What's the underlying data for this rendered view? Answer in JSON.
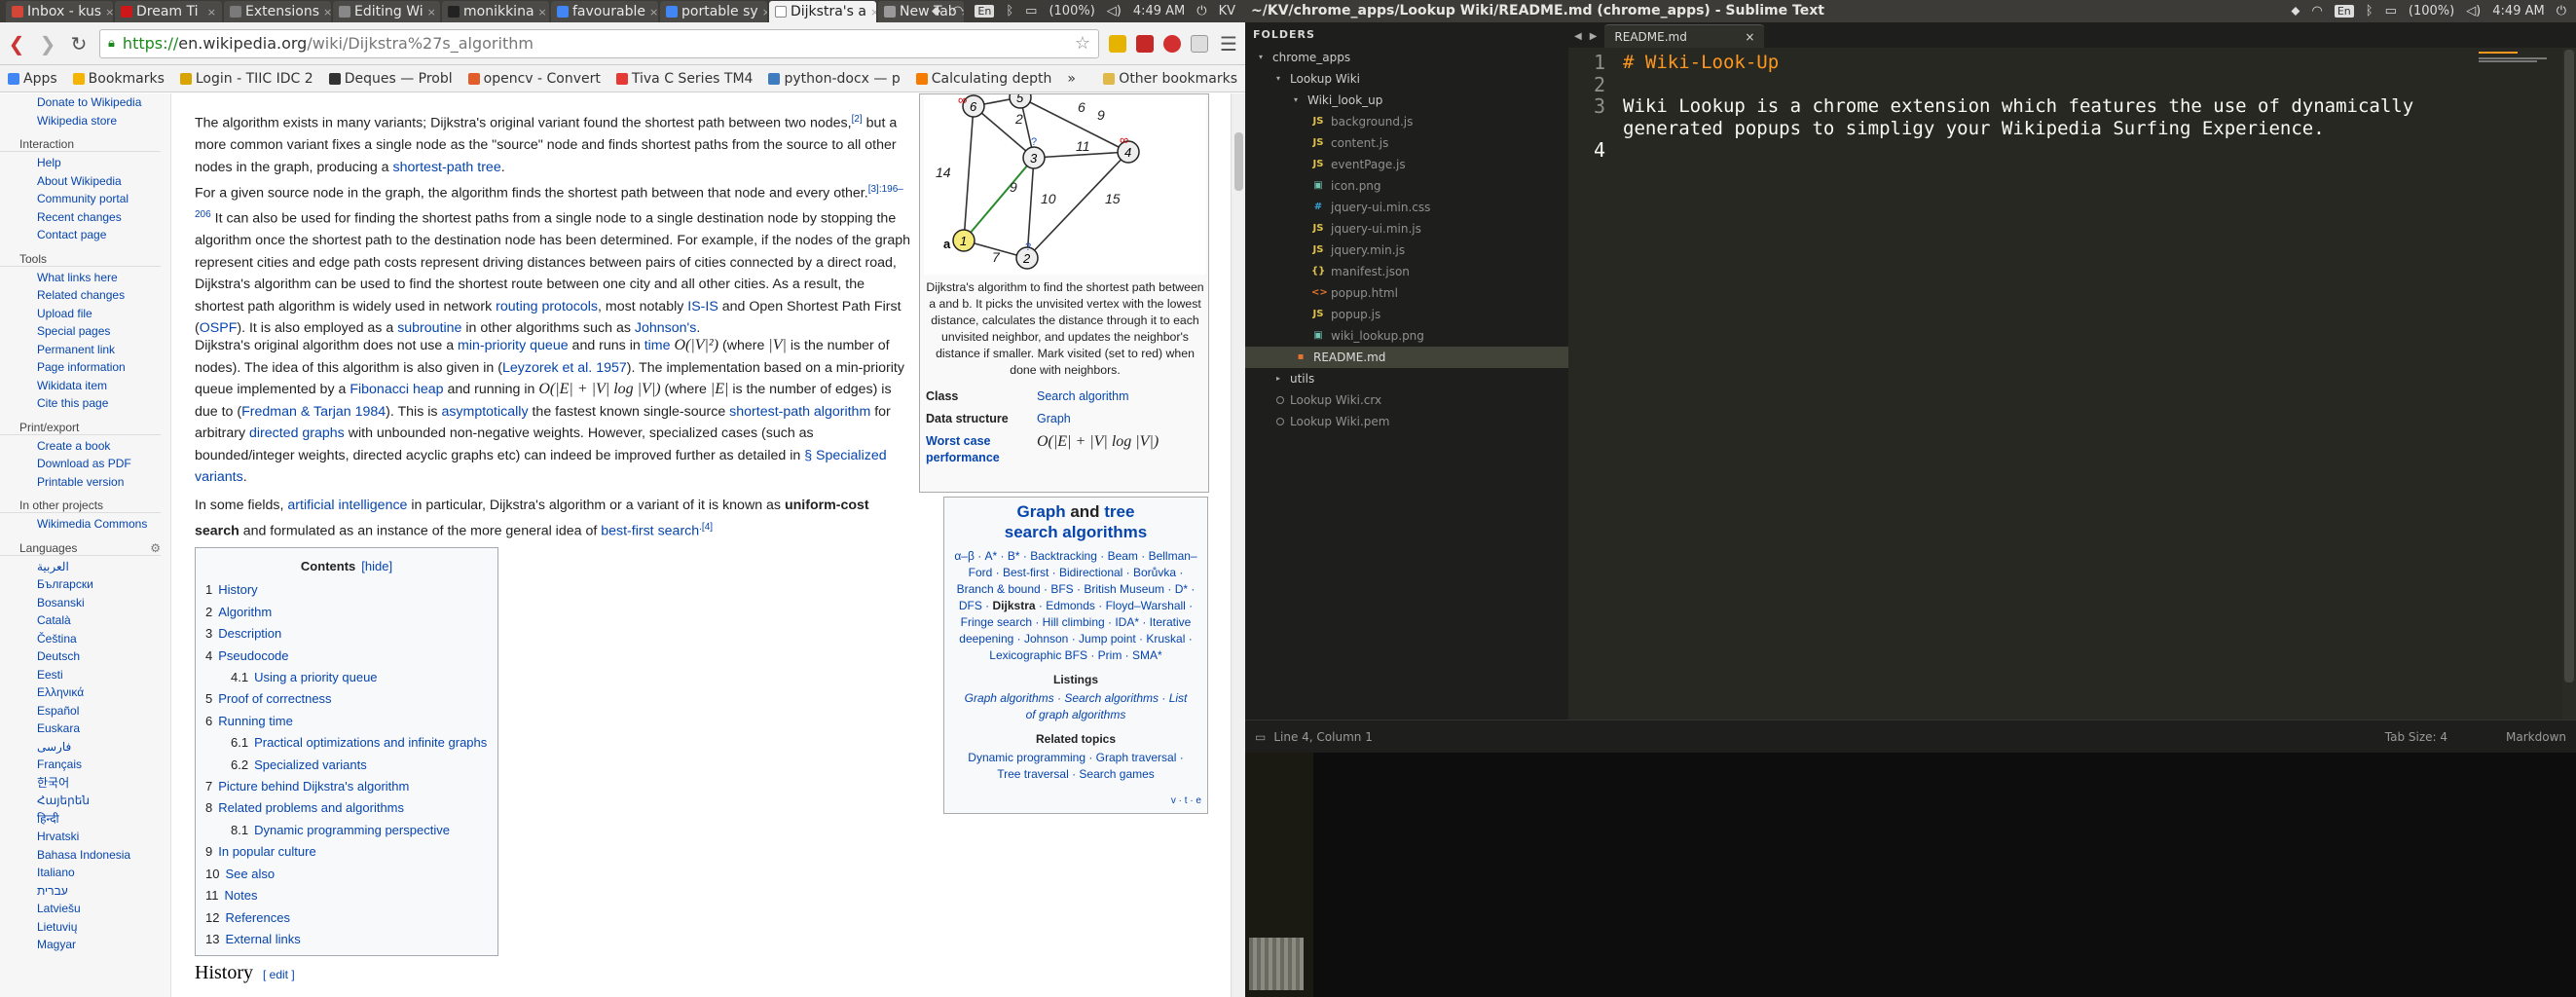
{
  "system": {
    "time": "4:49 AM",
    "battery": "(100%)",
    "lang": "En",
    "menu_right": "KV"
  },
  "chrome": {
    "tabs": [
      {
        "label": "Inbox - kus",
        "color": "#d44638"
      },
      {
        "label": "Dream Ti",
        "color": "#cc1818"
      },
      {
        "label": "Extensions",
        "color": "#7a7a7a"
      },
      {
        "label": "Editing Wi",
        "color": "#888"
      },
      {
        "label": "monikkina",
        "color": "#222"
      },
      {
        "label": "favourable",
        "color": "#4285f4"
      },
      {
        "label": "portable sy",
        "color": "#4285f4"
      },
      {
        "label": "Dijkstra's a",
        "color": "#fff"
      },
      {
        "label": "New Tab",
        "color": "#999"
      }
    ],
    "url_scheme": "https://",
    "url_host": "en.wikipedia.org",
    "url_path": "/wiki/Dijkstra%27s_algorithm",
    "bookmarks": [
      "Apps",
      "Bookmarks",
      "Login - TIIC IDC 2",
      "Deques — Probl",
      "opencv - Convert",
      "Tiva C Series TM4",
      "python-docx — p",
      "Calculating depth"
    ],
    "bookmarks_more": "»",
    "other_bookmarks": "Other bookmarks"
  },
  "wiki": {
    "sidebar_top": [
      "Donate to Wikipedia",
      "Wikipedia store"
    ],
    "interaction_head": "Interaction",
    "interaction": [
      "Help",
      "About Wikipedia",
      "Community portal",
      "Recent changes",
      "Contact page"
    ],
    "tools_head": "Tools",
    "tools": [
      "What links here",
      "Related changes",
      "Upload file",
      "Special pages",
      "Permanent link",
      "Page information",
      "Wikidata item",
      "Cite this page"
    ],
    "print_head": "Print/export",
    "print": [
      "Create a book",
      "Download as PDF",
      "Printable version"
    ],
    "other_head": "In other projects",
    "other": [
      "Wikimedia Commons"
    ],
    "lang_head": "Languages",
    "languages": [
      "العربية",
      "Български",
      "Bosanski",
      "Català",
      "Čeština",
      "Deutsch",
      "Eesti",
      "Ελληνικά",
      "Español",
      "Euskara",
      "فارسی",
      "Français",
      "한국어",
      "Հայերեն",
      "हिन्दी",
      "Hrvatski",
      "Bahasa Indonesia",
      "Italiano",
      "עברית",
      "Latviešu",
      "Lietuvių",
      "Magyar"
    ],
    "p1a": "The algorithm exists in many variants; Dijkstra's original variant found the shortest path between two nodes,",
    "p1ref": "[2]",
    "p1b": " but a more common variant fixes a single node as the \"source\" node and finds shortest paths from the source to all other nodes in the graph, producing a ",
    "p1link": "shortest-path tree",
    "p1c": ".",
    "p2a": "For a given source node in the graph, the algorithm finds the shortest path between that node and every other.",
    "p2ref": "[3]:196–206",
    "p2b": " It can also be used for finding the shortest paths from a single node to a single destination node by stopping the algorithm once the shortest path to the destination node has been determined. For example, if the nodes of the graph represent cities and edge path costs represent driving distances between pairs of cities connected by a direct road, Dijkstra's algorithm can be used to find the shortest route between one city and all other cities. As a result, the shortest path algorithm is widely used in network ",
    "p2l1": "routing protocols",
    "p2c": ", most notably ",
    "p2l2": "IS-IS",
    "p2d": " and Open Shortest Path First (",
    "p2l3": "OSPF",
    "p2e": "). It is also employed as a ",
    "p2l4": "subroutine",
    "p2f": " in other algorithms such as ",
    "p2l5": "Johnson's",
    "p2g": ".",
    "p3a": "Dijkstra's original algorithm does not use a ",
    "p3l1": "min-priority queue",
    "p3b": " and runs in ",
    "p3l2": "time",
    "p3m1": "O(|V|²)",
    "p3c": " (where ",
    "p3m2": "|V|",
    "p3d": " is the number of nodes). The idea of this algorithm is also given in (",
    "p3l3": "Leyzorek et al. 1957",
    "p3e": "). The implementation based on a min-priority queue implemented by a ",
    "p3l4": "Fibonacci heap",
    "p3f": " and running in ",
    "p3m3": "O(|E| + |V| log |V|)",
    "p3g": " (where ",
    "p3m4": "|E|",
    "p3h": " is the number of edges) is due to (",
    "p3l5": "Fredman & Tarjan 1984",
    "p3i": "). This is ",
    "p3l6": "asymptotically",
    "p3j": " the fastest known single-source ",
    "p3l7": "shortest-path algorithm",
    "p3k": " for arbitrary ",
    "p3l8": "directed graphs",
    "p3m": " with unbounded non-negative weights. However, specialized cases (such as bounded/integer weights, directed acyclic graphs etc) can indeed be improved further as detailed in ",
    "p3l9": "§ Specialized variants",
    "p3n": ".",
    "p4a": "In some fields, ",
    "p4l1": "artificial intelligence",
    "p4b": " in particular, Dijkstra's algorithm or a variant of it is known as ",
    "p4bold": "uniform-cost search",
    "p4c": " and formulated as an instance of the more general idea of ",
    "p4l2": "best-first search",
    "p4ref": ".[4]",
    "toc_title": "Contents",
    "toc_hide": "[hide]",
    "toc": [
      {
        "n": "1",
        "t": "History",
        "sub": false
      },
      {
        "n": "2",
        "t": "Algorithm",
        "sub": false
      },
      {
        "n": "3",
        "t": "Description",
        "sub": false
      },
      {
        "n": "4",
        "t": "Pseudocode",
        "sub": false
      },
      {
        "n": "4.1",
        "t": "Using a priority queue",
        "sub": true
      },
      {
        "n": "5",
        "t": "Proof of correctness",
        "sub": false
      },
      {
        "n": "6",
        "t": "Running time",
        "sub": false
      },
      {
        "n": "6.1",
        "t": "Practical optimizations and infinite graphs",
        "sub": true
      },
      {
        "n": "6.2",
        "t": "Specialized variants",
        "sub": true
      },
      {
        "n": "7",
        "t": "Picture behind Dijkstra's algorithm",
        "sub": false
      },
      {
        "n": "8",
        "t": "Related problems and algorithms",
        "sub": false
      },
      {
        "n": "8.1",
        "t": "Dynamic programming perspective",
        "sub": true
      },
      {
        "n": "9",
        "t": "In popular culture",
        "sub": false
      },
      {
        "n": "10",
        "t": "See also",
        "sub": false
      },
      {
        "n": "11",
        "t": "Notes",
        "sub": false
      },
      {
        "n": "12",
        "t": "References",
        "sub": false
      },
      {
        "n": "13",
        "t": "External links",
        "sub": false
      }
    ],
    "history_heading": "History",
    "history_edit": "[ edit ]",
    "infobox": {
      "caption": "Dijkstra's algorithm to find the shortest path between a and b. It picks the unvisited vertex with the lowest distance, calculates the distance through it to each unvisited neighbor, and updates the neighbor's distance if smaller. Mark visited (set to red) when done with neighbors.",
      "class_k": "Class",
      "class_v": "Search algorithm",
      "ds_k": "Data structure",
      "ds_v": "Graph",
      "wc_k": "Worst case performance",
      "wc_v": "O(|E| + |V| log |V|)",
      "nodes": [
        "6",
        "5",
        "3",
        "4",
        "1",
        "2"
      ],
      "edges": [
        "2",
        "9",
        "14",
        "11",
        "6",
        "9",
        "10",
        "15",
        "7"
      ],
      "node_a": "a",
      "node_b": "b",
      "infinity": "∞",
      "question": "?"
    },
    "navbox": {
      "title_a": "Graph",
      "title_b": " and ",
      "title_c": "tree",
      "title_d": "search algorithms",
      "list": "α–β · A* · B* · Backtracking · Beam · Bellman–Ford · Best-first · Bidirectional · Borůvka · Branch & bound · BFS · British Museum · D* · DFS · ",
      "current": "Dijkstra",
      "list2": " · Edmonds · Floyd–Warshall · Fringe search · Hill climbing · IDA* · Iterative deepening · Johnson · Jump point · Kruskal · Lexicographic BFS · Prim · SMA*",
      "listings": "Listings",
      "listings_items": "Graph algorithms · Search algorithms · List of graph algorithms",
      "related": "Related topics",
      "related_items": "Dynamic programming · Graph traversal · Tree traversal · Search games",
      "vte": "v · t · e"
    }
  },
  "sublime": {
    "title": "~/KV/chrome_apps/Lookup Wiki/README.md (chrome_apps) - Sublime Text",
    "folders": "FOLDERS",
    "tree": [
      {
        "label": "chrome_apps",
        "type": "dir",
        "depth": 0
      },
      {
        "label": "Lookup Wiki",
        "type": "dir",
        "depth": 1
      },
      {
        "label": "Wiki_look_up",
        "type": "dir",
        "depth": 2
      },
      {
        "label": "background.js",
        "type": "js",
        "depth": 3
      },
      {
        "label": "content.js",
        "type": "js",
        "depth": 3
      },
      {
        "label": "eventPage.js",
        "type": "js",
        "depth": 3
      },
      {
        "label": "icon.png",
        "type": "img",
        "depth": 3
      },
      {
        "label": "jquery-ui.min.css",
        "type": "css",
        "depth": 3
      },
      {
        "label": "jquery-ui.min.js",
        "type": "js",
        "depth": 3
      },
      {
        "label": "jquery.min.js",
        "type": "js",
        "depth": 3
      },
      {
        "label": "manifest.json",
        "type": "json",
        "depth": 3
      },
      {
        "label": "popup.html",
        "type": "html",
        "depth": 3
      },
      {
        "label": "popup.js",
        "type": "js",
        "depth": 3
      },
      {
        "label": "wiki_lookup.png",
        "type": "img",
        "depth": 3
      },
      {
        "label": "README.md",
        "type": "md",
        "depth": 2
      },
      {
        "label": "utils",
        "type": "dir",
        "depth": 1
      },
      {
        "label": "Lookup Wiki.crx",
        "type": "plain",
        "depth": 1
      },
      {
        "label": "Lookup Wiki.pem",
        "type": "plain",
        "depth": 1
      }
    ],
    "tab": "README.md",
    "lines": [
      "1",
      "2",
      "3",
      "4"
    ],
    "code_l1": "# Wiki-Look-Up",
    "code_l3a": "Wiki Lookup is a chrome extension which features the use of dynamically",
    "code_l3b": "generated popups to simpligy your Wikipedia Surfing Experience.",
    "status_left": "Line 4, Column 1",
    "status_tab": "Tab Size: 4",
    "status_syntax": "Markdown"
  }
}
